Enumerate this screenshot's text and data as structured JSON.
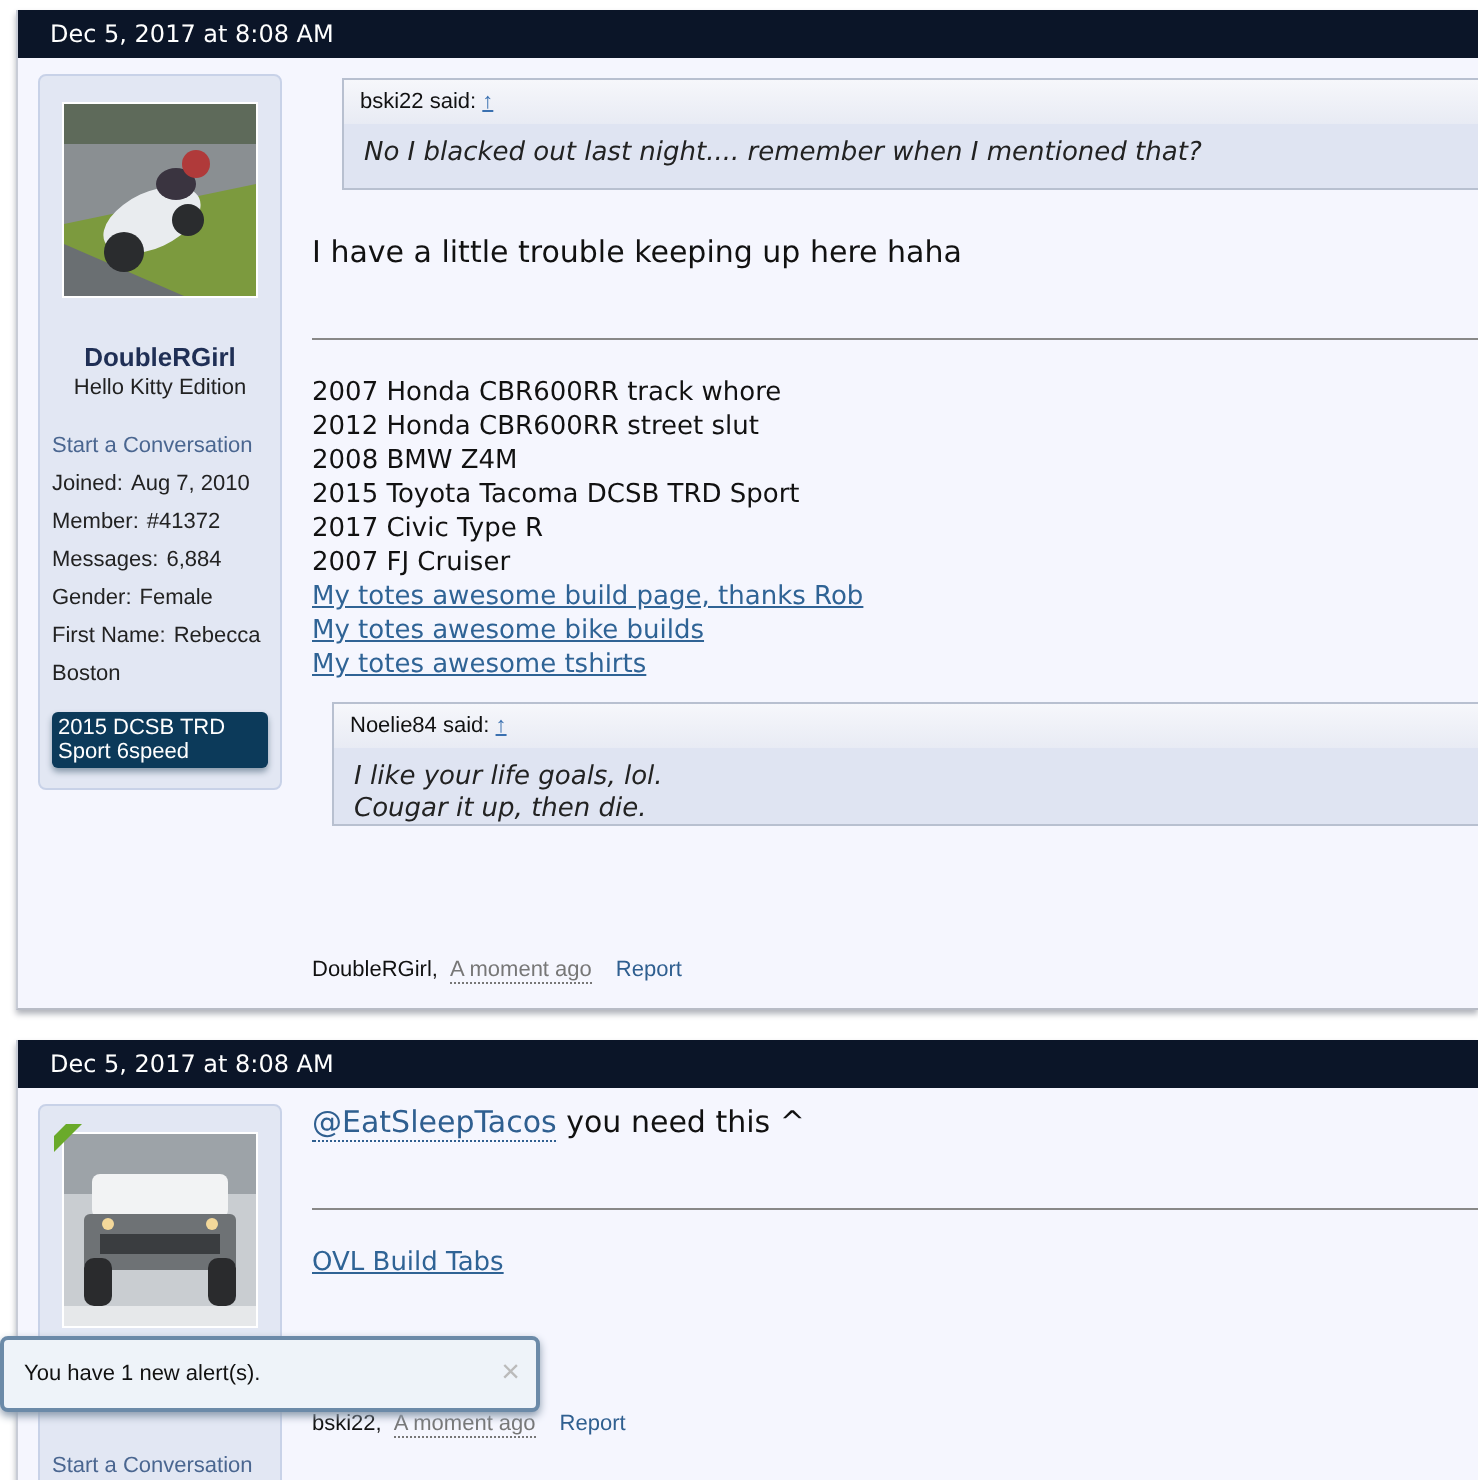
{
  "posts": [
    {
      "date": "Dec 5, 2017 at 8:08 AM",
      "user": {
        "online": false,
        "name": "DoubleRGirl",
        "title": "Hello Kitty Edition",
        "start_conversation": "Start a Conversation",
        "stats": [
          {
            "label": "Joined:",
            "value": "Aug 7, 2010"
          },
          {
            "label": "Member:",
            "value": "#41372"
          },
          {
            "label": "Messages:",
            "value": "6,884"
          },
          {
            "label": "Gender:",
            "value": "Female"
          },
          {
            "label": "First Name:",
            "value": "Rebecca"
          }
        ],
        "location": "Boston",
        "banner": "2015 DCSB TRD Sport 6speed"
      },
      "blocks": [
        {
          "kind": "quote",
          "attribution": "bski22 said:",
          "jump": "↑",
          "lines": [
            "No I blacked out last night.... remember when I mentioned that?"
          ]
        },
        {
          "kind": "text",
          "text": "I have a little trouble keeping up here haha"
        }
      ],
      "signature": {
        "lines": [
          {
            "text": "2007 Honda CBR600RR track whore",
            "link": false
          },
          {
            "text": "2012 Honda CBR600RR street slut",
            "link": false
          },
          {
            "text": "2008 BMW Z4M",
            "link": false
          },
          {
            "text": "2015 Toyota Tacoma DCSB TRD Sport",
            "link": false
          },
          {
            "text": "2017 Civic Type R",
            "link": false
          },
          {
            "text": "2007 FJ Cruiser",
            "link": false
          },
          {
            "text": "My totes awesome build page, thanks Rob",
            "link": true
          },
          {
            "text": "My totes awesome bike builds",
            "link": true
          },
          {
            "text": "My totes awesome tshirts",
            "link": true
          }
        ],
        "quote": {
          "kind": "quote",
          "attribution": "Noelie84 said:",
          "jump": "↑",
          "lines": [
            "I like your life goals, lol.",
            "Cougar it up, then die."
          ],
          "clipped": true
        }
      },
      "footer": {
        "author": "DoubleRGirl,",
        "time": "A moment ago",
        "report": "Report"
      }
    },
    {
      "date": "Dec 5, 2017 at 8:08 AM",
      "user": {
        "online": true,
        "start_conversation": "Start a Conversation"
      },
      "blocks": [
        {
          "kind": "mention",
          "mention": "@EatSleepTacos",
          "text": "you need this ^"
        }
      ],
      "signature": {
        "lines": [
          {
            "text": "OVL Build Tabs",
            "link": true
          }
        ]
      },
      "footer": {
        "author": "bski22,",
        "time": "A moment ago",
        "report": "Report"
      }
    }
  ],
  "toast": {
    "message": "You have 1 new alert(s).",
    "close": "×"
  }
}
